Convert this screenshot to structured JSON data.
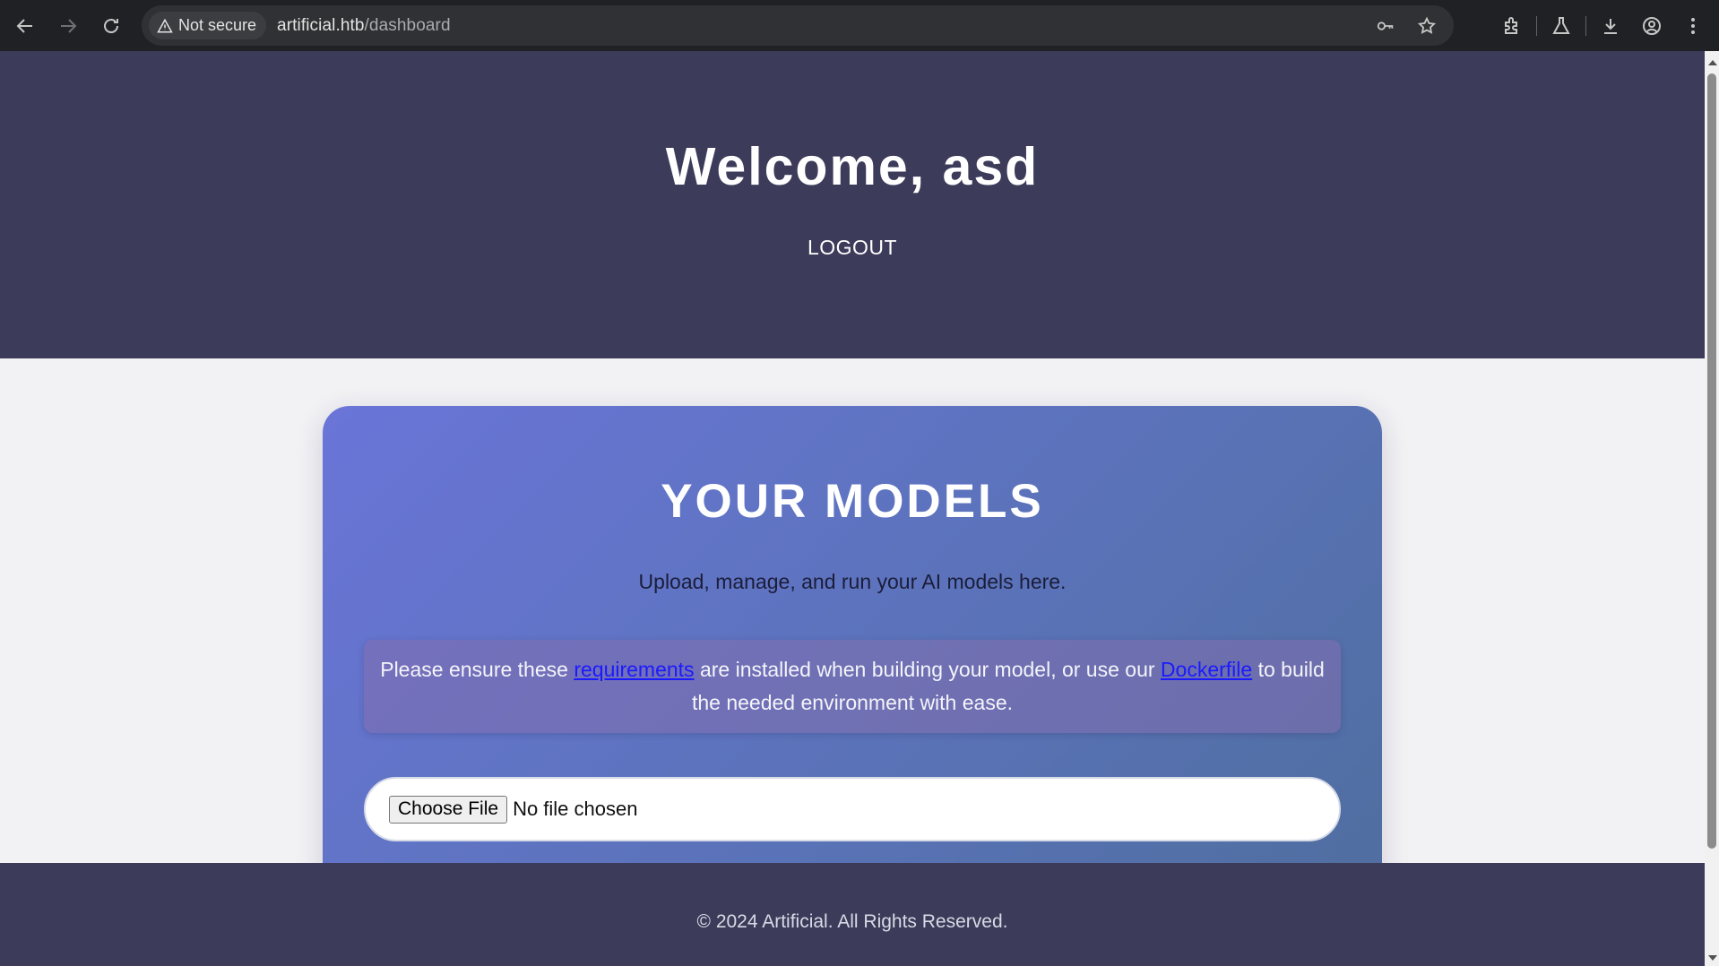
{
  "browser": {
    "security_label": "Not secure",
    "url_host": "artificial.htb",
    "url_path": "/dashboard",
    "icons": [
      "back-icon",
      "forward-icon",
      "reload-icon",
      "warning-icon",
      "key-icon",
      "star-icon",
      "extensions-icon",
      "labs-icon",
      "download-icon",
      "profile-icon",
      "menu-icon"
    ]
  },
  "header": {
    "welcome": "Welcome, asd",
    "logout_label": "LOGOUT"
  },
  "models": {
    "title": "YOUR MODELS",
    "subtitle": "Upload, manage, and run your AI models here.",
    "notice": {
      "text_before": "Please ensure these ",
      "link1": "requirements",
      "text_middle": " are installed when building your model, or use our ",
      "link2": "Dockerfile",
      "text_after": " to build the needed environment with ease."
    },
    "upload": {
      "button_label": "Choose File",
      "status": "No file chosen"
    }
  },
  "footer": {
    "copyright": "© 2024 Artificial. All Rights Reserved."
  },
  "colors": {
    "header_bg": "#3c3b5a",
    "card_gradient_start": "#6a75d8",
    "card_gradient_end": "#4f6e9f",
    "link": "#1a1aff"
  }
}
